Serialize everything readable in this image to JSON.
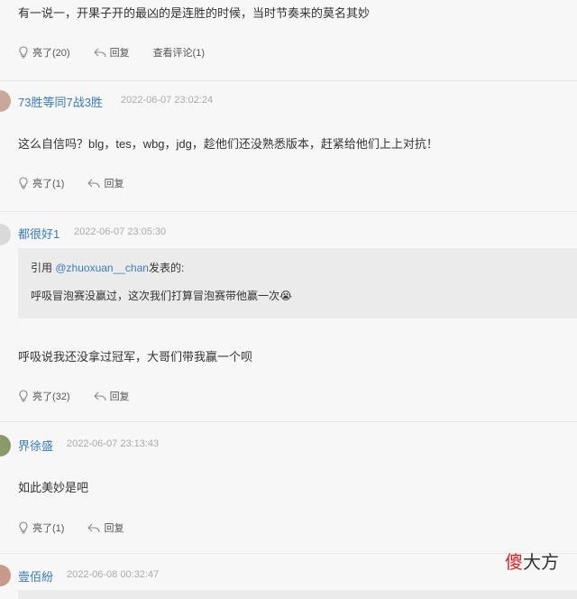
{
  "comments": [
    {
      "text": "有一说一，开果子开的最凶的是连胜的时候，当时节奏来的莫名其妙",
      "actions": {
        "like": "亮了(20)",
        "reply": "回复",
        "view": "查看评论(1)"
      }
    },
    {
      "username": "73胜等同7战3胜",
      "time": "2022-06-07 23:02:24",
      "text": "这么自信吗？blg，tes，wbg，jdg，趁他们还没熟悉版本，赶紧给他们上上对抗！",
      "actions": {
        "like": "亮了(1)",
        "reply": "回复"
      }
    },
    {
      "username": "都很好1",
      "time": "2022-06-07 23:05:30",
      "quote": {
        "prefix": "引用",
        "mention": "@zhuoxuan__chan",
        "suffix": "发表的:",
        "text": "呼吸冒泡赛没赢过，这次我们打算冒泡赛带他赢一次",
        "emoji": "😭"
      },
      "text": "呼吸说我还没拿过冠军，大哥们带我赢一个呗",
      "actions": {
        "like": "亮了(32)",
        "reply": "回复"
      }
    },
    {
      "username": "界徐盛",
      "time": "2022-06-07 23:13:43",
      "text": "如此美妙是吧",
      "actions": {
        "like": "亮了(1)",
        "reply": "回复"
      }
    },
    {
      "username": "壹佰紛",
      "time": "2022-06-08 00:32:47"
    }
  ],
  "watermark": {
    "highlight": "傻",
    "rest": "大方"
  },
  "colors": {
    "username": "#3a7bbf",
    "background": "#f7f7f7",
    "watermark_red": "#e02020"
  }
}
